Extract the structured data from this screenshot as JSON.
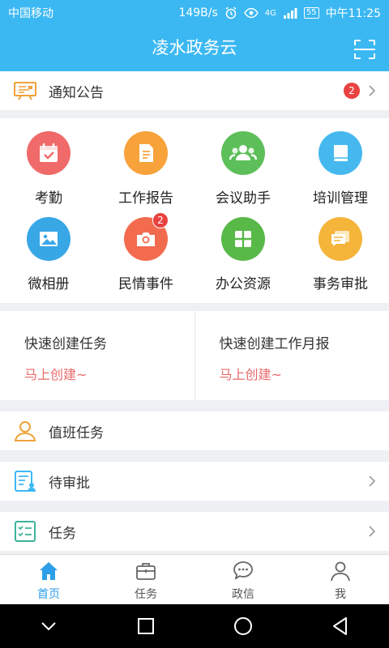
{
  "status": {
    "carrier": "中国移动",
    "speed": "149B/s",
    "network": "4G",
    "battery": "55",
    "time": "中午11:25"
  },
  "header": {
    "title": "凌水政务云"
  },
  "notice": {
    "label": "通知公告",
    "badge": "2"
  },
  "apps": [
    {
      "label": "考勤",
      "color": "#f06a6a",
      "icon": "calendar-check-icon"
    },
    {
      "label": "工作报告",
      "color": "#f7a23b",
      "icon": "document-icon"
    },
    {
      "label": "会议助手",
      "color": "#5dbf5a",
      "icon": "people-icon"
    },
    {
      "label": "培训管理",
      "color": "#45b9ee",
      "icon": "book-icon"
    },
    {
      "label": "微相册",
      "color": "#38a7e6",
      "icon": "photo-icon"
    },
    {
      "label": "民情事件",
      "color": "#f36b4f",
      "icon": "camera-icon",
      "badge": "2"
    },
    {
      "label": "办公资源",
      "color": "#58b948",
      "icon": "grid-icon"
    },
    {
      "label": "事务审批",
      "color": "#f5b43a",
      "icon": "chat-docs-icon"
    }
  ],
  "quick": [
    {
      "title": "快速创建任务",
      "link": "马上创建~"
    },
    {
      "title": "快速创建工作月报",
      "link": "马上创建~"
    }
  ],
  "rows": [
    {
      "label": "值班任务"
    },
    {
      "label": "待审批"
    },
    {
      "label": "任务"
    }
  ],
  "tabs": [
    {
      "label": "首页"
    },
    {
      "label": "任务"
    },
    {
      "label": "政信"
    },
    {
      "label": "我"
    }
  ],
  "colors": {
    "accent": "#3bb8f2",
    "tab_active": "#2d9ee8",
    "link": "#e96a6a",
    "badge": "#e84340"
  }
}
